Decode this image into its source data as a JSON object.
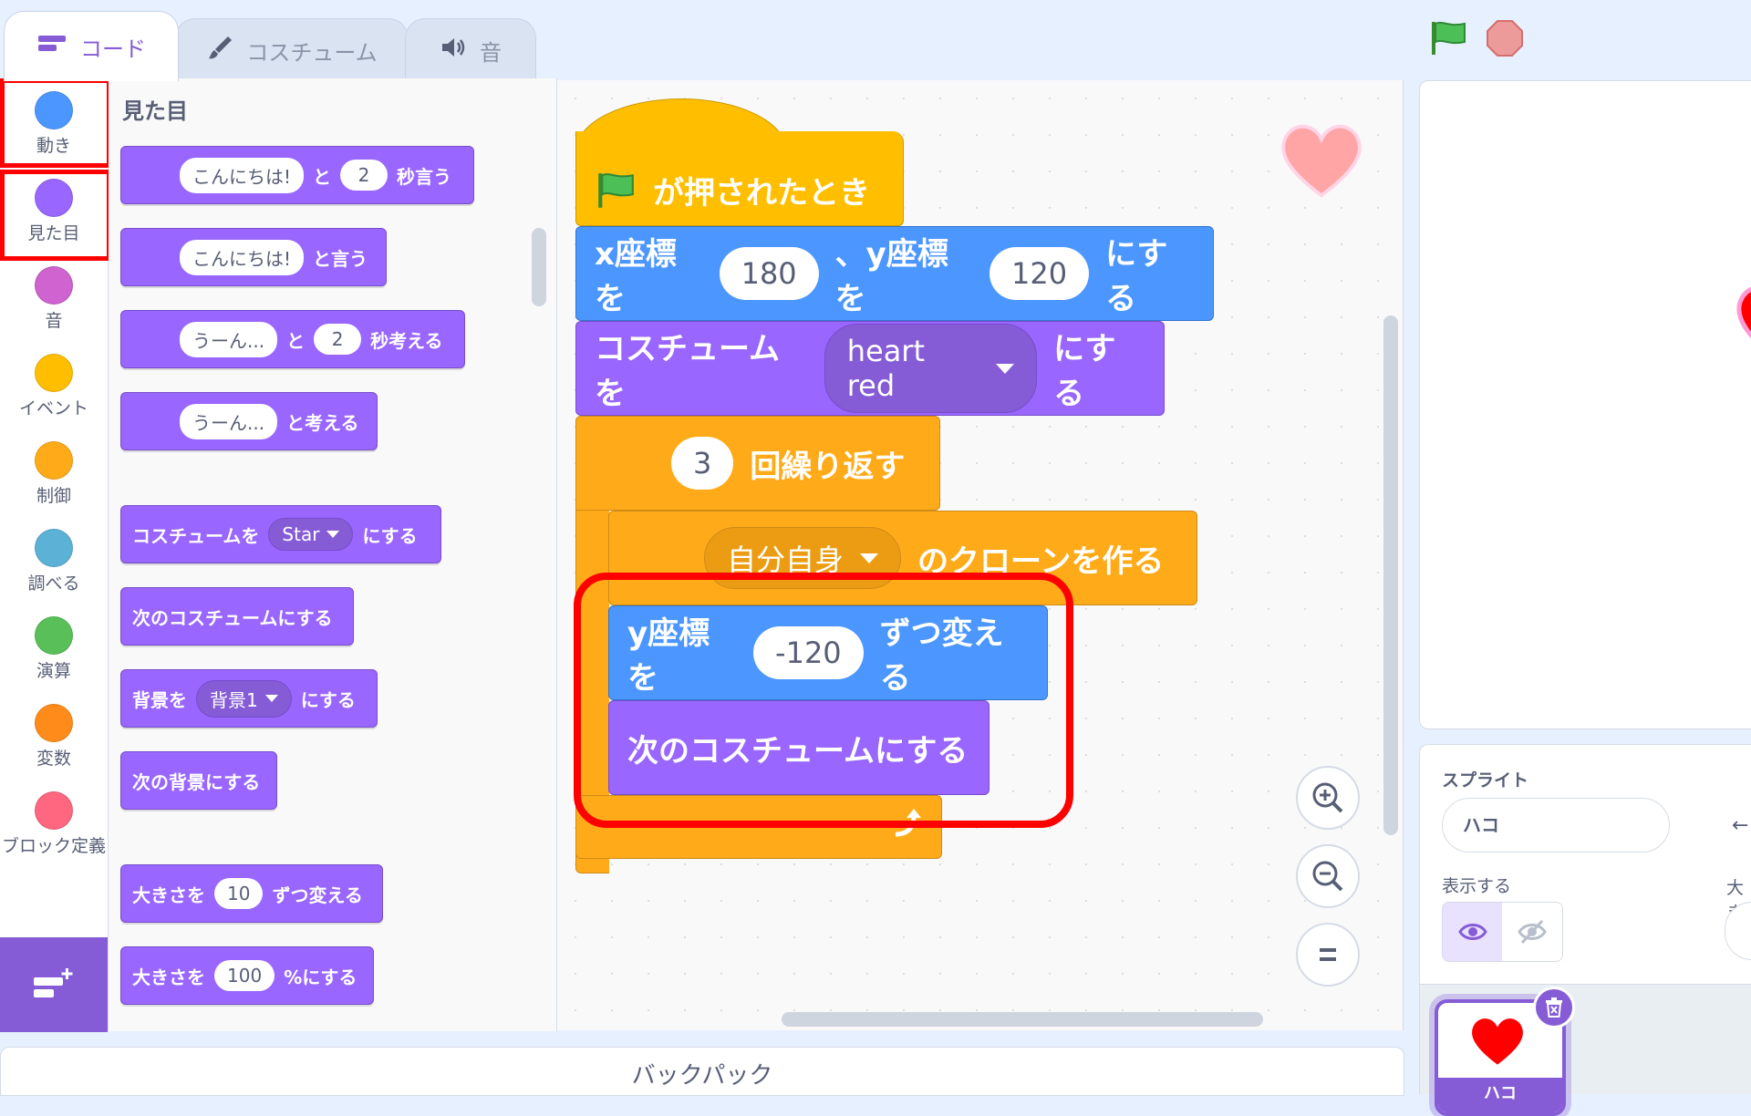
{
  "tabs": [
    {
      "label": "コード",
      "icon": "code-icon"
    },
    {
      "label": "コスチューム",
      "icon": "brush-icon"
    },
    {
      "label": "音",
      "icon": "speaker-icon"
    }
  ],
  "categories": [
    {
      "label": "動き",
      "color": "#4c97ff"
    },
    {
      "label": "見た目",
      "color": "#9966ff"
    },
    {
      "label": "音",
      "color": "#cf63cf"
    },
    {
      "label": "イベント",
      "color": "#ffbf00"
    },
    {
      "label": "制御",
      "color": "#ffab19"
    },
    {
      "label": "調べる",
      "color": "#5cb1d6"
    },
    {
      "label": "演算",
      "color": "#59c059"
    },
    {
      "label": "変数",
      "color": "#ff8c1a"
    },
    {
      "label": "ブロック定義",
      "color": "#ff6680"
    }
  ],
  "palette": {
    "section_title": "見た目",
    "say_for": {
      "text": "こんにちは!",
      "mid": "と",
      "num": "2",
      "end": "秒言う"
    },
    "say": {
      "text": "こんにちは!",
      "end": "と言う"
    },
    "think_for": {
      "text": "うーん...",
      "mid": "と",
      "num": "2",
      "end": "秒考える"
    },
    "think": {
      "text": "うーん...",
      "end": "と考える"
    },
    "switch_costume": {
      "start": "コスチュームを",
      "value": "Star",
      "end": "にする"
    },
    "next_costume": "次のコスチュームにする",
    "switch_backdrop": {
      "start": "背景を",
      "value": "背景1",
      "end": "にする"
    },
    "next_backdrop": "次の背景にする",
    "change_size": {
      "start": "大きさを",
      "num": "10",
      "end": "ずつ変える"
    },
    "set_size": {
      "start": "大きさを",
      "num": "100",
      "end": "%にする"
    }
  },
  "script": {
    "hat": "が押されたとき",
    "goto": {
      "start": "x座標を",
      "x": "180",
      "mid": "、y座標を",
      "y": "120",
      "end": "にする"
    },
    "costume": {
      "start": "コスチュームを",
      "value": "heart red",
      "end": "にする"
    },
    "repeat": {
      "num": "3",
      "end": "回繰り返す"
    },
    "clone": {
      "value": "自分自身",
      "end": "のクローンを作る"
    },
    "change_y": {
      "start": "y座標を",
      "num": "-120",
      "end": "ずつ変える"
    },
    "next_costume": "次のコスチュームにする"
  },
  "sprite_info": {
    "label": "スプライト",
    "name": "ハコ",
    "show_label": "表示する",
    "size_label": "大き"
  },
  "sprite_tile": {
    "name": "ハコ"
  },
  "backpack": "バックパック",
  "colors": {
    "motion": "#4c97ff",
    "looks": "#9966ff",
    "control": "#ffab19",
    "events": "#ffbf00",
    "highlight": "#ff0000",
    "accent": "#855cd6"
  }
}
